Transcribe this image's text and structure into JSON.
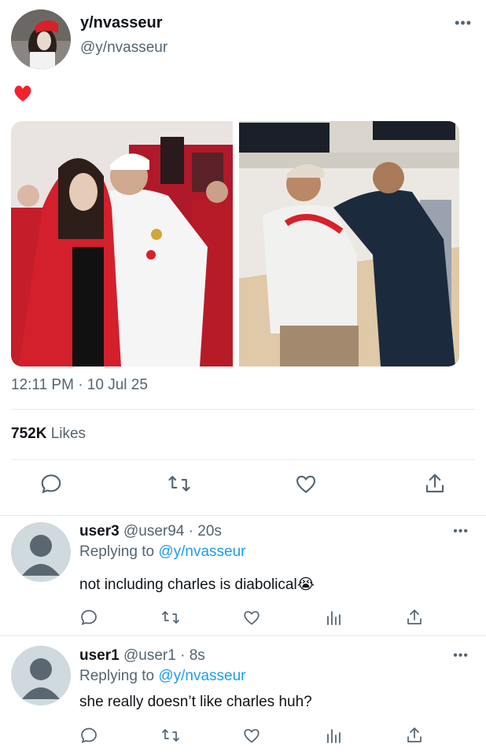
{
  "tweet": {
    "display_name": "y/nvasseur",
    "handle": "@y/nvasseur",
    "more_icon": "•••",
    "body_emoji": "red-heart",
    "timestamp": "12:11 PM · 10 Jul 25",
    "likes_count": "752K",
    "likes_label": "Likes",
    "media": [
      {
        "description_icon": "photo-ferrari-team"
      },
      {
        "description_icon": "photo-bowling-alley"
      }
    ]
  },
  "actions": [
    "reply-icon",
    "retweet-icon",
    "like-icon",
    "share-icon"
  ],
  "replies": [
    {
      "name": "user3",
      "handle": "@user94",
      "time": "· 20s",
      "replying_label": "Replying to",
      "replying_handle": "@y/nvasseur",
      "text": "not including charles is diabolical😭"
    },
    {
      "name": "user1",
      "handle": "@user1",
      "time": "· 8s",
      "replying_label": "Replying to",
      "replying_handle": "@y/nvasseur",
      "text": "she really doesn’t like charles huh?"
    }
  ],
  "colors": {
    "accent": "#1d9bf0",
    "muted": "#536471",
    "text": "#0f1419",
    "divider": "#e6e9ec",
    "heart": "#f4212e"
  }
}
